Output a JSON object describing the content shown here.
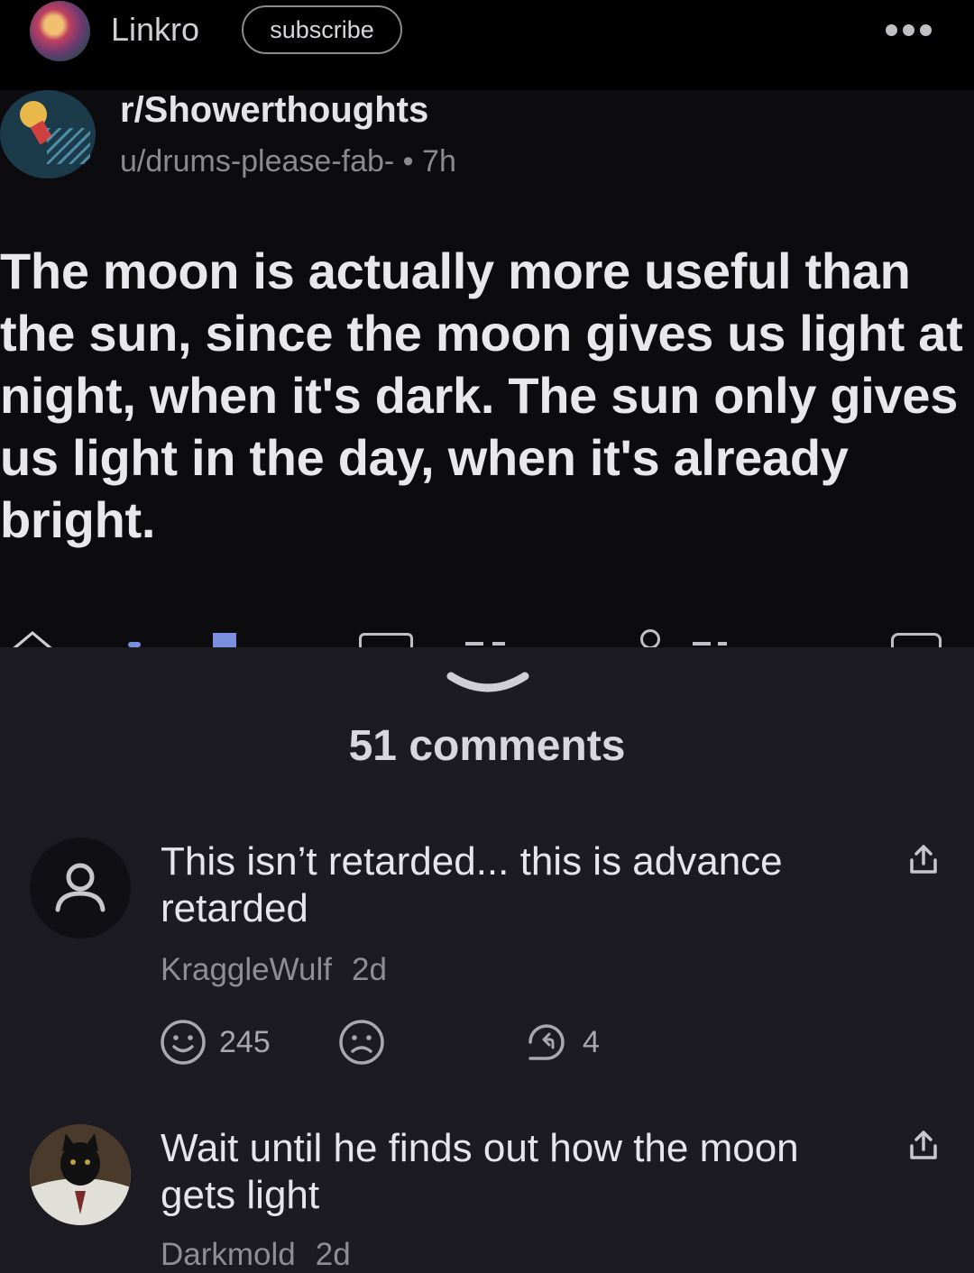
{
  "header": {
    "username": "Linkro",
    "subscribe_label": "subscribe",
    "more_icon": "more-horizontal-icon"
  },
  "post": {
    "subreddit": "r/Showerthoughts",
    "meta": "u/drums-please-fab- • 7h",
    "text": "The moon is actually more useful than the sun, since the moon gives us light at night, when it's dark. The sun only gives us light in the day, when it's already bright."
  },
  "comments_section": {
    "title": "51 comments",
    "comments": [
      {
        "text": "This isn’t retarded... this is advance retarded",
        "author": "KraggleWulf",
        "time": "2d",
        "likes": "245",
        "replies": "4"
      },
      {
        "text": "Wait until he finds out how the moon gets light",
        "author": "Darkmold",
        "time": "2d"
      }
    ]
  },
  "colors": {
    "background": "#1c1b21",
    "topbar": "#000000",
    "text": "#e6e6ea",
    "muted": "#8e8e93",
    "accent": "#7b8fe0"
  }
}
